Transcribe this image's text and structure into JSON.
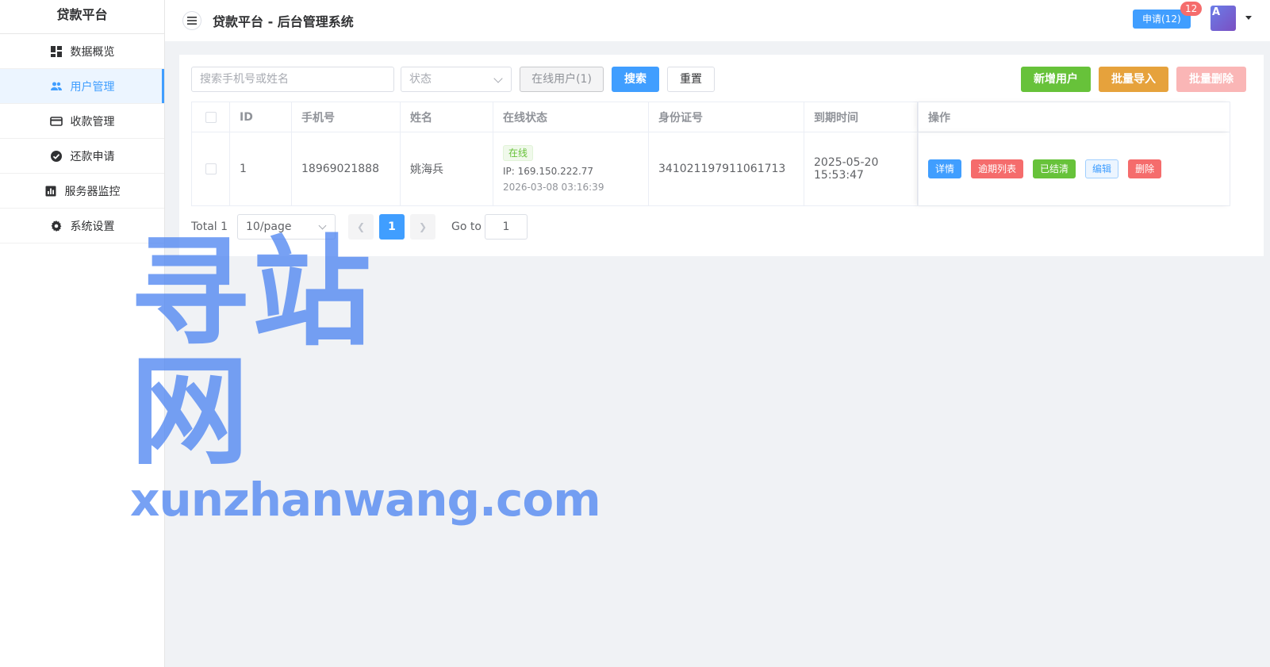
{
  "sidebar": {
    "title": "贷款平台",
    "items": [
      {
        "label": "数据概览",
        "icon": "dashboard-icon"
      },
      {
        "label": "用户管理",
        "icon": "users-icon",
        "active": true
      },
      {
        "label": "收款管理",
        "icon": "credit-card-icon"
      },
      {
        "label": "还款申请",
        "icon": "check-circle-icon"
      },
      {
        "label": "服务器监控",
        "icon": "bar-chart-icon"
      },
      {
        "label": "系统设置",
        "icon": "gear-icon"
      }
    ]
  },
  "header": {
    "title": "贷款平台 - 后台管理系统",
    "apply_button": "申请(12)",
    "badge_count": "12",
    "avatar_letter": "A"
  },
  "toolbar": {
    "search_placeholder": "搜索手机号或姓名",
    "status_placeholder": "状态",
    "online_users_button": "在线用户(1)",
    "search_button": "搜索",
    "reset_button": "重置",
    "add_user_button": "新增用户",
    "batch_import_button": "批量导入",
    "batch_delete_button": "批量删除"
  },
  "table": {
    "columns": [
      "ID",
      "手机号",
      "姓名",
      "在线状态",
      "身份证号",
      "到期时间",
      "操作"
    ],
    "rows": [
      {
        "id": "1",
        "phone": "18969021888",
        "name": "姚海兵",
        "online_tag": "在线",
        "ip": "IP: 169.150.222.77",
        "online_time": "2026-03-08 03:16:39",
        "id_card": "341021197911061713",
        "expire_time": "2025-05-20 15:53:47",
        "actions": [
          "详情",
          "逾期列表",
          "已结清",
          "编辑",
          "删除"
        ]
      }
    ]
  },
  "pagination": {
    "total_label": "Total 1",
    "page_size": "10/page",
    "current_page": "1",
    "goto_label": "Go to",
    "goto_value": "1"
  },
  "watermark": {
    "line1": "寻站网",
    "line2": "xunzhanwang.com"
  },
  "colors": {
    "primary": "#409eff",
    "success": "#67c23a",
    "warning": "#e6a23c",
    "danger": "#f56c6c"
  }
}
